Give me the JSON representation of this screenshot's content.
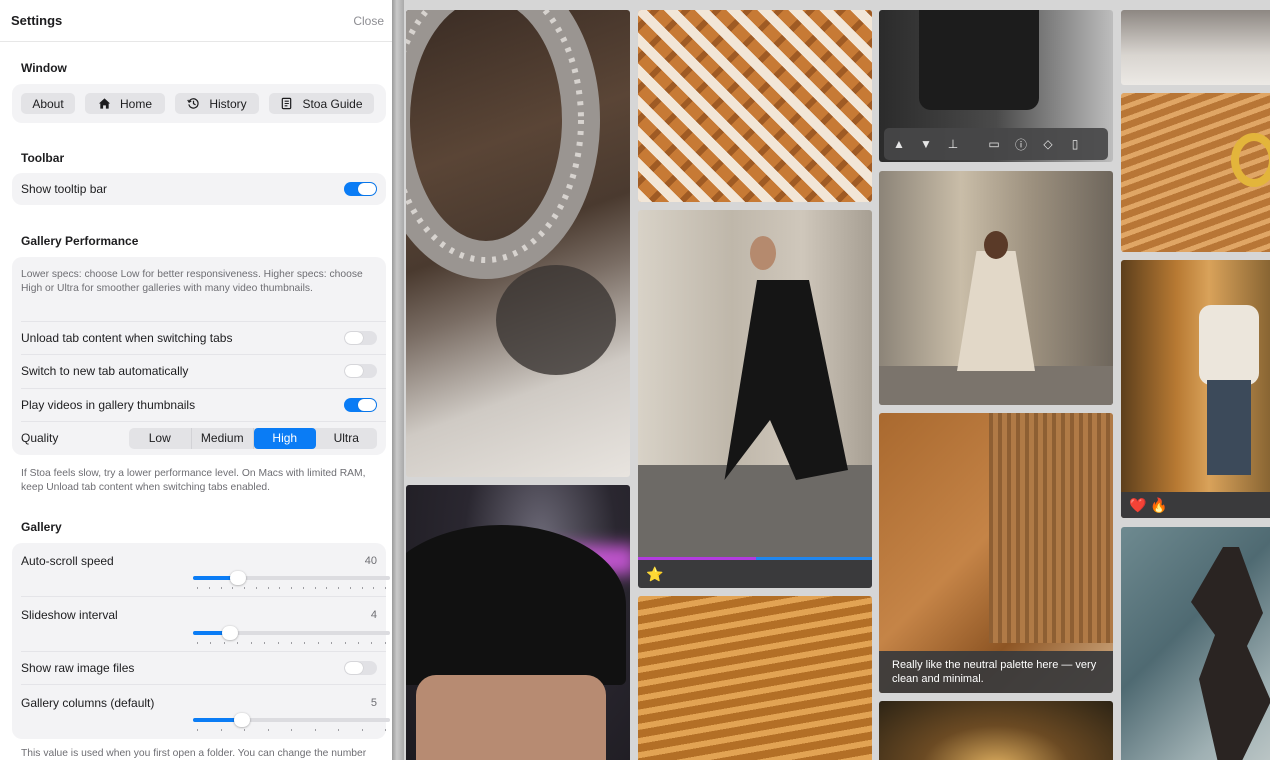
{
  "header": {
    "title": "Settings",
    "close_label": "Close"
  },
  "window_section": {
    "title": "Window",
    "buttons": {
      "about": "About",
      "home": "Home",
      "history": "History",
      "guide": "Stoa Guide"
    }
  },
  "toolbar_section": {
    "title": "Toolbar",
    "show_tooltip_bar": {
      "label": "Show tooltip bar",
      "enabled": true
    }
  },
  "performance_section": {
    "title": "Gallery Performance",
    "description": "Lower specs: choose Low for better responsiveness. Higher specs: choose High or Ultra for smoother galleries with many video thumbnails.",
    "unload_tabs": {
      "label": "Unload tab content when switching tabs",
      "enabled": false
    },
    "switch_new_tab": {
      "label": "Switch to new tab automatically",
      "enabled": false
    },
    "play_videos": {
      "label": "Play videos in gallery thumbnails",
      "enabled": true
    },
    "quality": {
      "label": "Quality",
      "options": [
        "Low",
        "Medium",
        "High",
        "Ultra"
      ],
      "selected": "High"
    },
    "footnote": "If Stoa feels slow, try a lower performance level. On Macs with limited RAM, keep Unload tab content when switching tabs enabled."
  },
  "gallery_section": {
    "title": "Gallery",
    "auto_scroll_speed": {
      "label": "Auto-scroll speed",
      "value": "40",
      "fraction": 0.23
    },
    "slideshow_interval": {
      "label": "Slideshow interval",
      "value": "4",
      "fraction": 0.19
    },
    "show_raw": {
      "label": "Show raw image files",
      "enabled": false
    },
    "gallery_columns": {
      "label": "Gallery columns (default)",
      "value": "5",
      "fraction": 0.25
    },
    "footnote": "This value is used when you first open a folder. You can change the number"
  },
  "gallery": {
    "tiles": {
      "ring": {
        "subject": "silver ring"
      },
      "houndstooth": {
        "subject": "houndstooth fabric"
      },
      "jacket": {
        "subject": "dark jacket"
      },
      "ring_top": {
        "subject": "silver ring"
      },
      "knit_gold": {
        "subject": "knit with gold ring"
      },
      "walker_dark": {
        "subject": "woman in dark coat",
        "reactions": "⭐"
      },
      "walker_trench": {
        "subject": "woman in trench coat"
      },
      "autumn": {
        "subject": "woman in autumn forest",
        "reactions": "❤️ 🔥"
      },
      "bangs": {
        "subject": "portrait with bangs"
      },
      "coat_closeup": {
        "subject": "camel coat with scarf",
        "comment": "Really like the neutral palette here — very clean and minimal."
      },
      "knit_mustard": {
        "subject": "mustard knit"
      },
      "sunset": {
        "subject": "portrait at sunset"
      },
      "sculptural": {
        "subject": "sculptural dress"
      }
    },
    "media_toolbar": [
      "up-icon",
      "down-icon",
      "pin-icon",
      "comment-icon",
      "info-icon",
      "tag-icon",
      "trash-icon"
    ]
  },
  "colors": {
    "accent": "#0a7cf5",
    "panel_bg": "#ffffff",
    "card_bg": "#f3f3f5"
  }
}
